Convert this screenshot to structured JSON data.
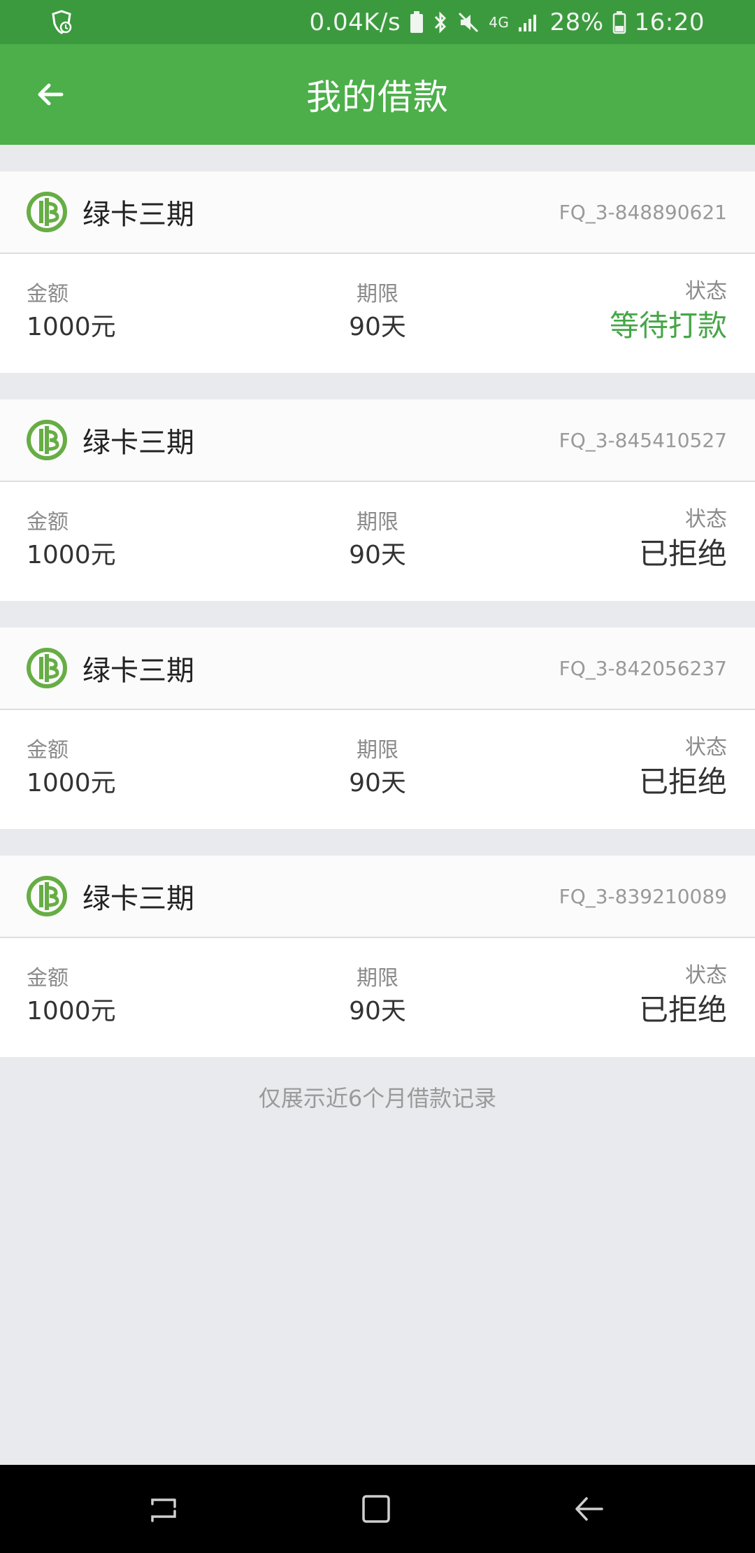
{
  "status_bar": {
    "network_speed": "0.04K/s",
    "signal_type": "4G",
    "battery": "28%",
    "time": "16:20"
  },
  "header": {
    "title": "我的借款",
    "back_icon": "arrow-left-icon"
  },
  "loans": [
    {
      "product": "绿卡三期",
      "order_id": "FQ_3-848890621",
      "amount_label": "金额",
      "amount": "1000元",
      "term_label": "期限",
      "term": "90天",
      "status_label": "状态",
      "status": "等待打款",
      "status_color": "#46a647"
    },
    {
      "product": "绿卡三期",
      "order_id": "FQ_3-845410527",
      "amount_label": "金额",
      "amount": "1000元",
      "term_label": "期限",
      "term": "90天",
      "status_label": "状态",
      "status": "已拒绝",
      "status_color": "#333333"
    },
    {
      "product": "绿卡三期",
      "order_id": "FQ_3-842056237",
      "amount_label": "金额",
      "amount": "1000元",
      "term_label": "期限",
      "term": "90天",
      "status_label": "状态",
      "status": "已拒绝",
      "status_color": "#333333"
    },
    {
      "product": "绿卡三期",
      "order_id": "FQ_3-839210089",
      "amount_label": "金额",
      "amount": "1000元",
      "term_label": "期限",
      "term": "90天",
      "status_label": "状态",
      "status": "已拒绝",
      "status_color": "#333333"
    }
  ],
  "footnote": "仅展示近6个月借款记录",
  "colors": {
    "status_bar": "#3c9a3e",
    "app_bar": "#4caf4a",
    "accent": "#46a647",
    "background": "#e8eaed"
  },
  "nav_bar": {
    "recents_icon": "recents-icon",
    "home_icon": "home-icon",
    "back_icon": "back-icon"
  }
}
